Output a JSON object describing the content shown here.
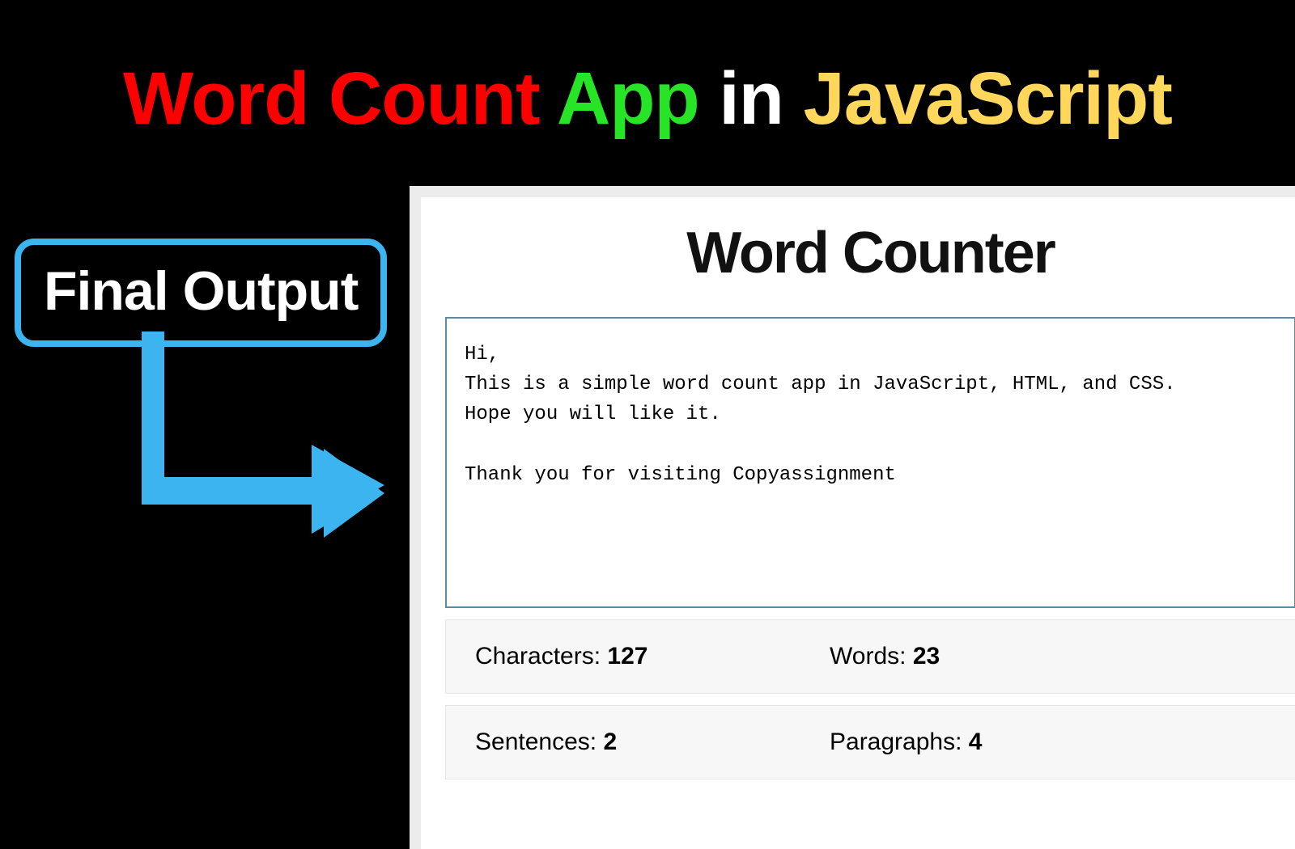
{
  "title": {
    "part1": "Word Count",
    "part2": "App",
    "part3": "in",
    "part4": "JavaScript"
  },
  "callout": {
    "label": "Final Output"
  },
  "app": {
    "heading": "Word Counter",
    "textarea_value": "Hi,\nThis is a simple word count app in JavaScript, HTML, and CSS.\nHope you will like it.\n\nThank you for visiting Copyassignment",
    "stats": {
      "characters": {
        "label": "Characters: ",
        "value": "127"
      },
      "words": {
        "label": "Words: ",
        "value": "23"
      },
      "sentences": {
        "label": "Sentences: ",
        "value": "2"
      },
      "paragraphs": {
        "label": "Paragraphs: ",
        "value": "4"
      }
    }
  },
  "colors": {
    "accent_blue": "#3cb4f0",
    "title_red": "#ff0000",
    "title_green": "#27e427",
    "title_yellow": "#ffd75a"
  }
}
